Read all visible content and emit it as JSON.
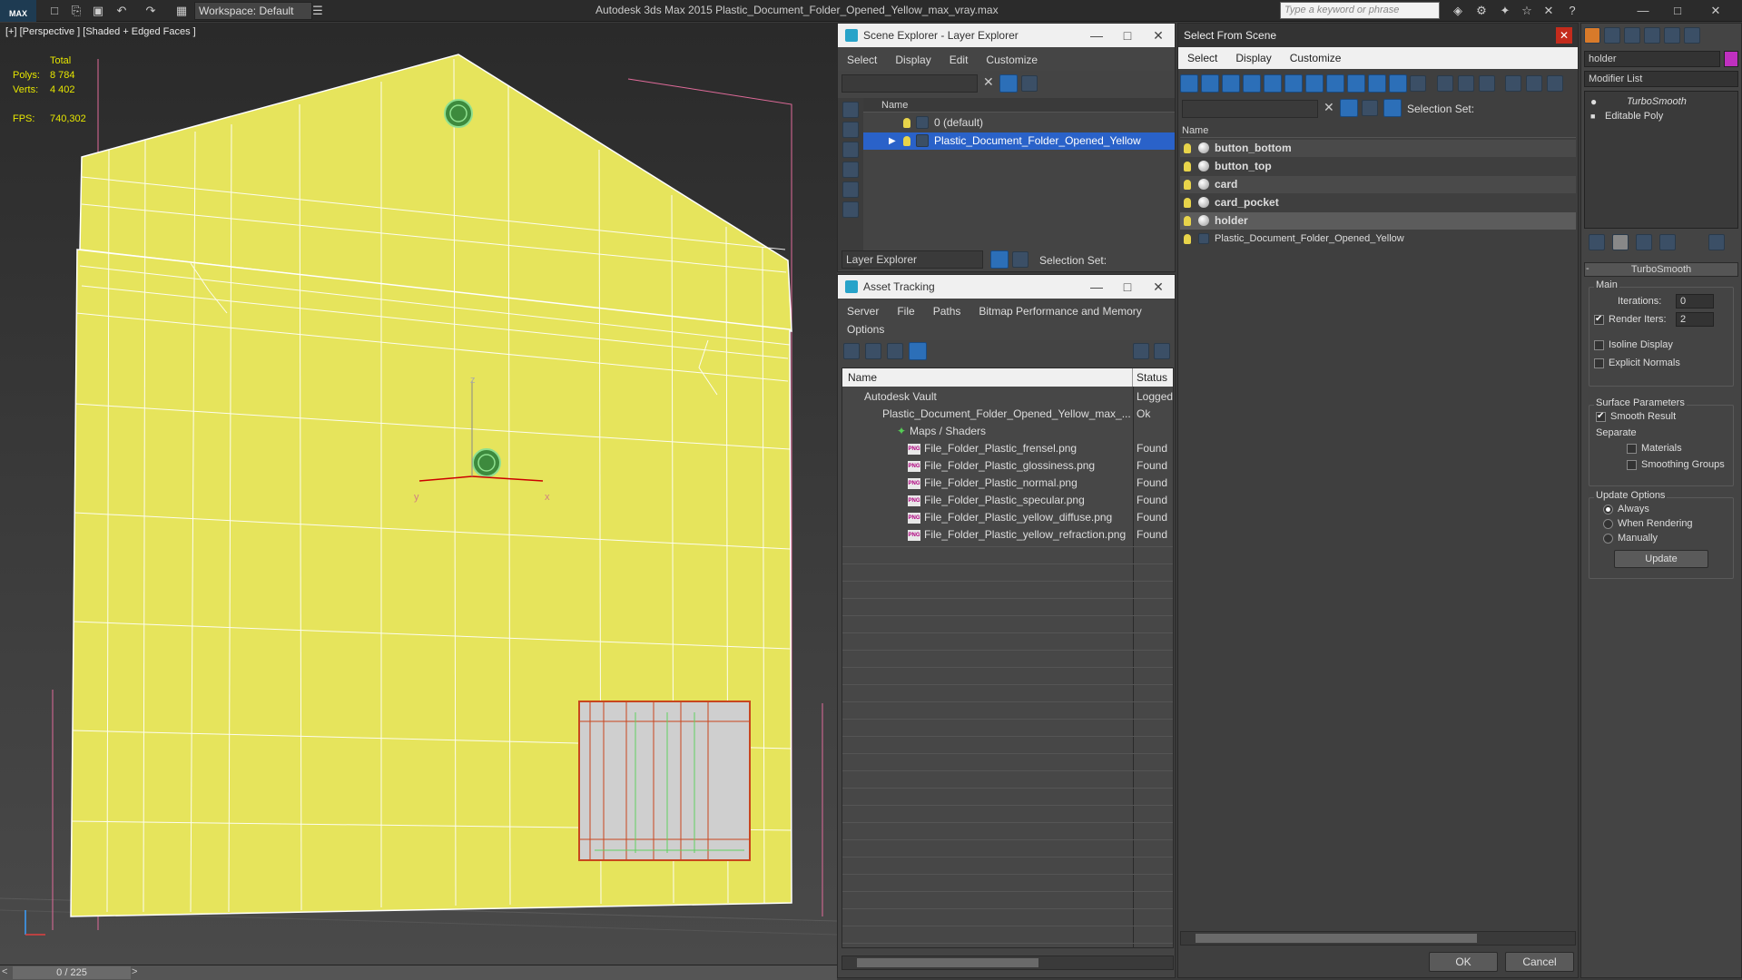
{
  "app": {
    "title": "Autodesk 3ds Max  2015    Plastic_Document_Folder_Opened_Yellow_max_vray.max",
    "logo": "MAX",
    "workspace": "Workspace: Default",
    "search_placeholder": "Type a keyword or phrase"
  },
  "viewport": {
    "label": "[+] [Perspective ] [Shaded + Edged Faces ]",
    "stats": {
      "total_label": "Total",
      "polys_label": "Polys:",
      "polys_value": "8 784",
      "verts_label": "Verts:",
      "verts_value": "4 402",
      "fps_label": "FPS:",
      "fps_value": "740,302"
    },
    "axes": {
      "x": "x",
      "y": "y",
      "z": "z"
    },
    "timeline": "0 / 225"
  },
  "scene_explorer": {
    "title": "Scene Explorer - Layer Explorer",
    "menu": [
      "Select",
      "Display",
      "Edit",
      "Customize"
    ],
    "col_name": "Name",
    "layers": [
      "0 (default)",
      "Plastic_Document_Folder_Opened_Yellow"
    ],
    "footer_dropdown": "Layer Explorer",
    "selection_set": "Selection Set:"
  },
  "asset_tracking": {
    "title": "Asset Tracking",
    "menu": [
      "Server",
      "File",
      "Paths",
      "Bitmap Performance and Memory"
    ],
    "menu2": [
      "Options"
    ],
    "col_name": "Name",
    "col_status": "Status",
    "rows": [
      {
        "name": "Autodesk Vault",
        "status": "Logged"
      },
      {
        "name": "Plastic_Document_Folder_Opened_Yellow_max_...",
        "status": "Ok"
      },
      {
        "name": "Maps / Shaders",
        "status": ""
      },
      {
        "name": "File_Folder_Plastic_frensel.png",
        "status": "Found"
      },
      {
        "name": "File_Folder_Plastic_glossiness.png",
        "status": "Found"
      },
      {
        "name": "File_Folder_Plastic_normal.png",
        "status": "Found"
      },
      {
        "name": "File_Folder_Plastic_specular.png",
        "status": "Found"
      },
      {
        "name": "File_Folder_Plastic_yellow_diffuse.png",
        "status": "Found"
      },
      {
        "name": "File_Folder_Plastic_yellow_refraction.png",
        "status": "Found"
      }
    ]
  },
  "select_from_scene": {
    "title": "Select From Scene",
    "menu": [
      "Select",
      "Display",
      "Customize"
    ],
    "selection_set": "Selection Set:",
    "col_name": "Name",
    "objects": [
      "button_bottom",
      "button_top",
      "card",
      "card_pocket",
      "holder",
      "Plastic_Document_Folder_Opened_Yellow"
    ],
    "ok": "OK",
    "cancel": "Cancel"
  },
  "modifier_panel": {
    "object_name": "holder",
    "modifier_list": "Modifier List",
    "stack": [
      "TurboSmooth",
      "Editable Poly"
    ],
    "rollout_title": "TurboSmooth",
    "main_label": "Main",
    "iterations_label": "Iterations:",
    "iterations_value": "0",
    "render_iters_label": "Render Iters:",
    "render_iters_value": "2",
    "isoline": "Isoline Display",
    "explicit_normals": "Explicit Normals",
    "surface_params": "Surface Parameters",
    "smooth_result": "Smooth Result",
    "separate": "Separate",
    "materials": "Materials",
    "smoothing_groups": "Smoothing Groups",
    "update_options": "Update Options",
    "always": "Always",
    "when_rendering": "When Rendering",
    "manually": "Manually",
    "update": "Update"
  },
  "colors": {
    "folder": "#e6e45c",
    "selection": "#2a62c9",
    "panel_bg": "#444444"
  }
}
